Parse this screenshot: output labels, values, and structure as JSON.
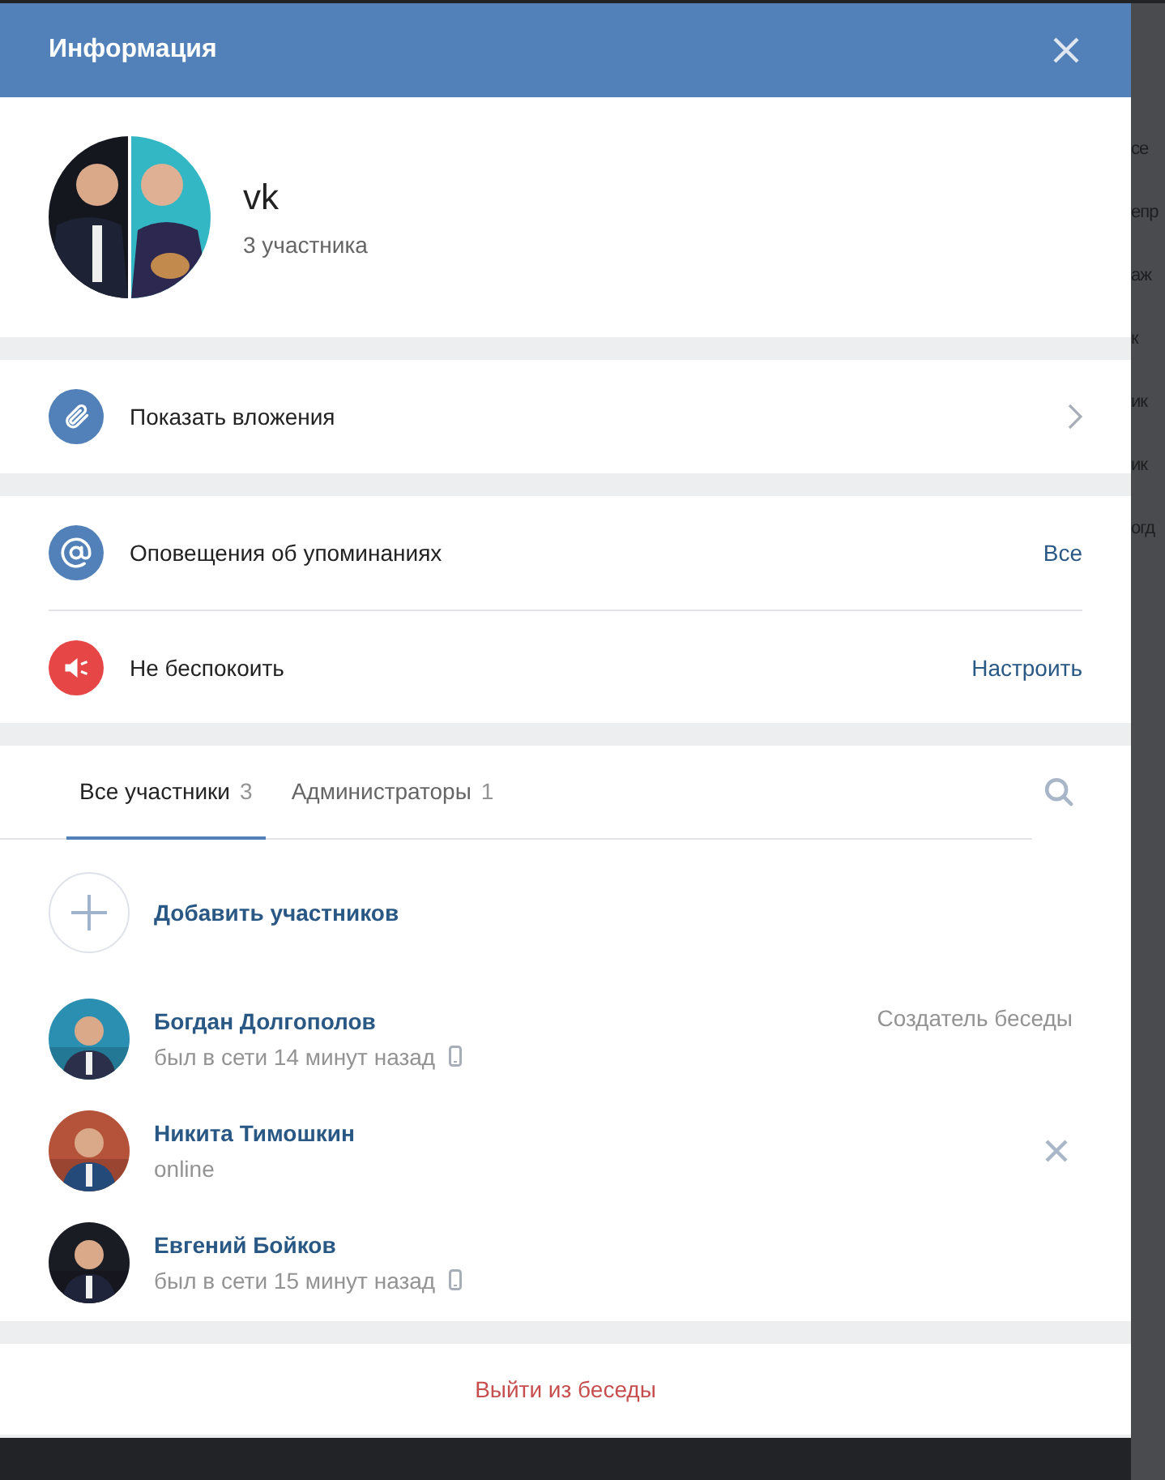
{
  "window": {
    "title": "Информация"
  },
  "chat": {
    "name": "vk",
    "members_count": "3 участника"
  },
  "links": [
    {
      "kind": "attachment",
      "label": "Показать вложения"
    }
  ],
  "settings": [
    {
      "kind": "mention",
      "label": "Оповещения об упоминаниях",
      "value": "Все"
    },
    {
      "kind": "mute",
      "label": "Не беспокоить",
      "value": "Настроить"
    }
  ],
  "tabs": [
    {
      "label": "Все участники",
      "count": "3",
      "selected": true
    },
    {
      "label": "Администраторы",
      "count": "1",
      "selected": false
    }
  ],
  "add_member": {
    "label": "Добавить участников"
  },
  "members": [
    {
      "name": "Богдан Долгополов",
      "status": "был в сети 14 минут назад",
      "mobile": true,
      "note": "Создатель беседы",
      "removable": false
    },
    {
      "name": "Никита Тимошкин",
      "status": "online",
      "mobile": false,
      "removable": true
    },
    {
      "name": "Евгений Бойков",
      "status": "был в сети 15 минут назад",
      "mobile": true,
      "removable": false
    }
  ],
  "leave": {
    "label": "Выйти из беседы"
  },
  "background_fragments": [
    "се",
    "епр",
    "аж",
    "к",
    "ик",
    "ик",
    "огд"
  ]
}
